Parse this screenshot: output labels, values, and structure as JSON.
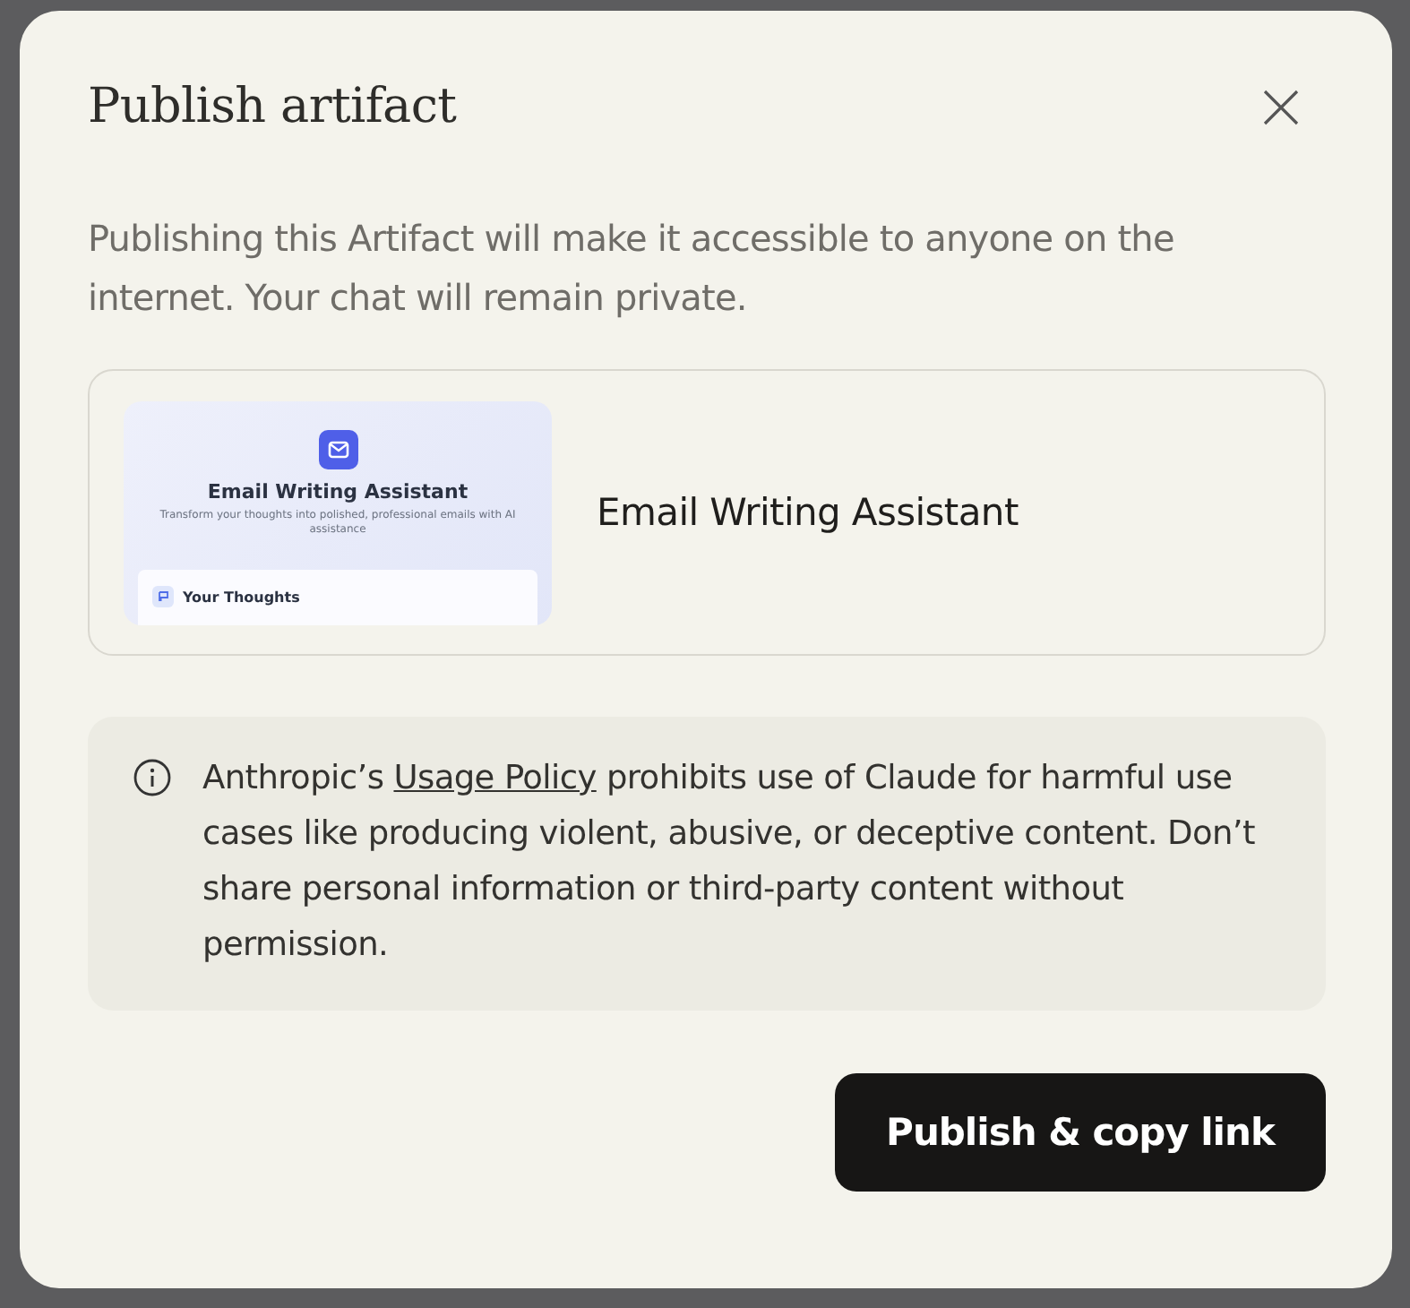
{
  "dialog": {
    "title": "Publish artifact",
    "description": "Publishing this Artifact will make it accessible to anyone on the internet. Your chat will remain private.",
    "artifact": {
      "name": "Email Writing Assistant",
      "preview": {
        "heading": "Email Writing Assistant",
        "subtitle": "Transform your thoughts into polished, professional emails with AI assistance",
        "section_label": "Your Thoughts"
      }
    },
    "notice": {
      "before": "Anthropic’s ",
      "link": "Usage Policy",
      "after": " prohibits use of Claude for harmful use cases like producing violent, abusive, or deceptive content. Don’t share personal information or third-party content without permission."
    },
    "primary_button": "Publish & copy link"
  }
}
